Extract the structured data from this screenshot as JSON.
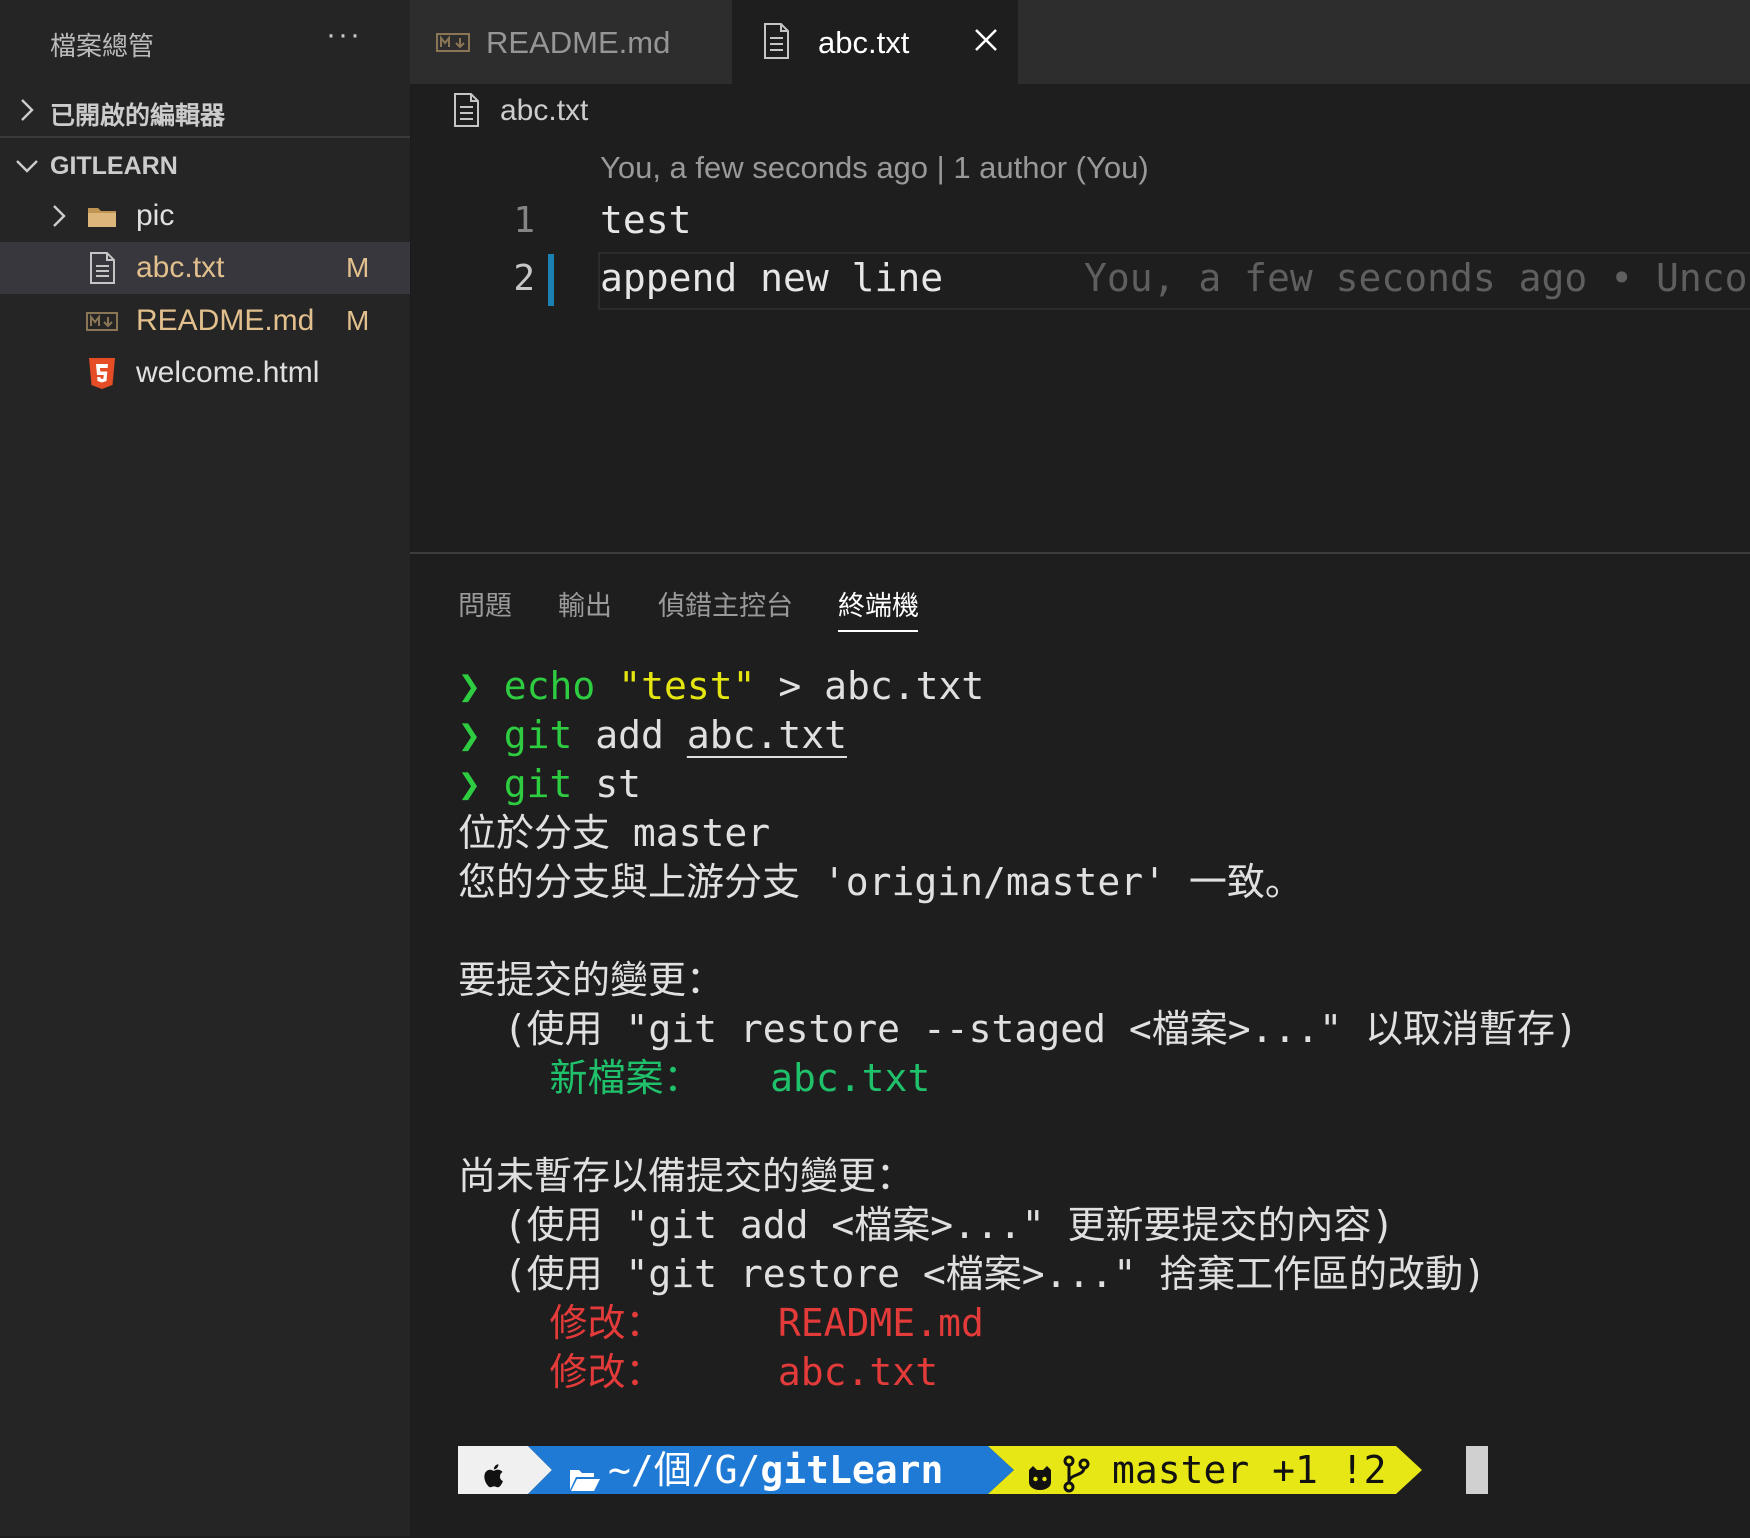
{
  "sidebar": {
    "title": "檔案總管",
    "more_label": "···",
    "open_editors_label": "已開啟的編輯器",
    "project_label": "GITLEARN",
    "items": [
      {
        "name": "pic",
        "badge": ""
      },
      {
        "name": "abc.txt",
        "badge": "M"
      },
      {
        "name": "README.md",
        "badge": "M"
      },
      {
        "name": "welcome.html",
        "badge": ""
      }
    ]
  },
  "tabs": [
    {
      "label": "README.md"
    },
    {
      "label": "abc.txt"
    }
  ],
  "editor": {
    "breadcrumb": "abc.txt",
    "codelens": "You, a few seconds ago | 1 author (You)",
    "lines": [
      {
        "number": "1",
        "text": "test"
      },
      {
        "number": "2",
        "text": "append new line"
      }
    ],
    "inline_blame": "You, a few seconds ago • Unco"
  },
  "panel": {
    "tabs": [
      "問題",
      "輸出",
      "偵錯主控台",
      "終端機"
    ]
  },
  "terminal": {
    "prompt_symbol": "❯",
    "cmd1": {
      "a": "echo",
      "b": "\"test\"",
      "c": " > abc.txt"
    },
    "cmd2": {
      "a": "git",
      "b": " add ",
      "c": "abc.txt"
    },
    "cmd3": {
      "a": "git",
      "b": " st"
    },
    "out1": "位於分支 master",
    "out2": "您的分支與上游分支 'origin/master' 一致。",
    "out3": "要提交的變更：",
    "out4": "  (使用 \"git restore --staged <檔案>...\" 以取消暫存)",
    "out5_label": "新檔案：",
    "out5_file": "abc.txt",
    "out6": "尚未暫存以備提交的變更：",
    "out7": "  (使用 \"git add <檔案>...\" 更新要提交的內容)",
    "out8": "  (使用 \"git restore <檔案>...\" 捨棄工作區的改動)",
    "out9_label": "修改：",
    "out9_file": "README.md",
    "out10_label": "修改：",
    "out10_file": "abc.txt",
    "path": "~/個/G/",
    "path_bold": "gitLearn",
    "branch": "master +1 !2"
  },
  "colors": {
    "accent_blue": "#1b80b2",
    "modified": "#e2c08d",
    "prompt_green": "#2ecc40",
    "string_yellow": "#e5e510",
    "staged_green": "#1fc16b",
    "unstaged_red": "#e33a3a",
    "prompt_seg_white": "#f0f0f0",
    "prompt_seg_blue": "#1f7ad6",
    "prompt_seg_yellow": "#e7e715"
  }
}
